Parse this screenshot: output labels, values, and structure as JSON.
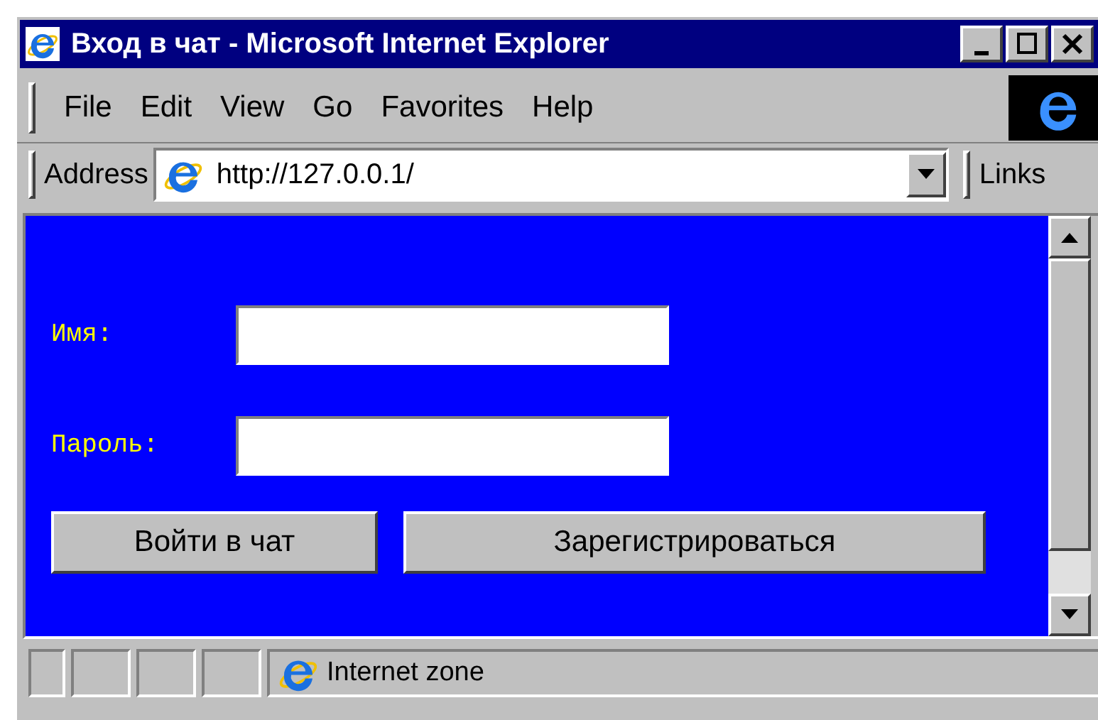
{
  "window": {
    "title": "Вход в чат - Microsoft Internet Explorer"
  },
  "menu": [
    "File",
    "Edit",
    "View",
    "Go",
    "Favorites",
    "Help"
  ],
  "address_bar": {
    "label": "Address",
    "value": "http://127.0.0.1/",
    "links": "Links"
  },
  "form": {
    "fields": [
      {
        "label": "Имя:"
      },
      {
        "label": "Пароль:"
      }
    ],
    "buttons": [
      "Войти в чат",
      "Зарегистрироваться"
    ]
  },
  "status_bar": {
    "zone": "Internet zone"
  }
}
